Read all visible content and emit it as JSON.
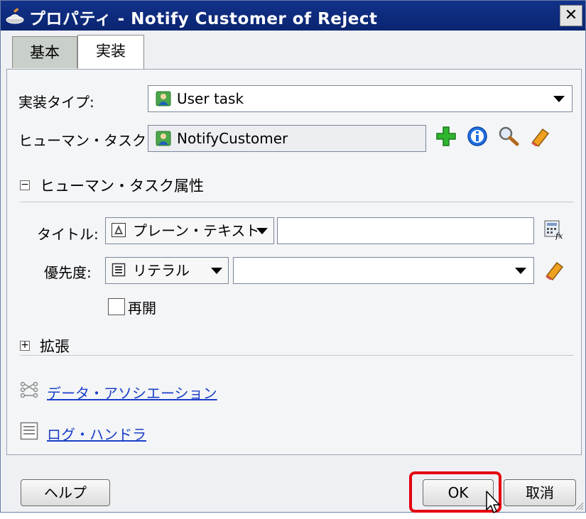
{
  "window": {
    "title": "プロパティ - Notify Customer of Reject",
    "close_glyph": "✕"
  },
  "tabs": [
    {
      "label": "基本",
      "active": false
    },
    {
      "label": "実装",
      "active": true
    }
  ],
  "form": {
    "impl_type_label": "実装タイプ:",
    "impl_type_value": "User task",
    "human_task_label": "ヒューマン・タスク:",
    "human_task_value": "NotifyCustomer"
  },
  "human_task_attrs": {
    "section_label": "ヒューマン・タスク属性",
    "title_label": "タイトル:",
    "title_type": "プレーン・テキスト",
    "title_value": "",
    "priority_label": "優先度:",
    "priority_type": "リテラル",
    "priority_value": "",
    "reopen_label": "再開",
    "reopen_checked": false
  },
  "extension": {
    "section_label": "拡張"
  },
  "links": {
    "data_association": "データ・アソシエーション",
    "log_handler": "ログ・ハンドラ"
  },
  "buttons": {
    "help": "ヘルプ",
    "ok": "OK",
    "cancel": "取消"
  },
  "colors": {
    "titlebar": "#0a2470",
    "link": "#1a3fc8",
    "highlight": "#e4000f",
    "add_icon": "#2fb52f",
    "info_icon": "#1f6fe0"
  }
}
